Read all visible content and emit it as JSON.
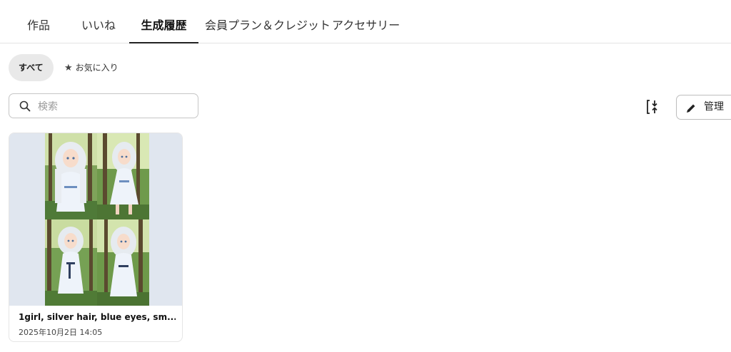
{
  "tabs": [
    {
      "label": "作品"
    },
    {
      "label": "いいね"
    },
    {
      "label": "生成履歴"
    },
    {
      "label": "会員プラン＆クレジット"
    },
    {
      "label": "アクセサリー"
    }
  ],
  "active_tab": "生成履歴",
  "filters": {
    "all_label": "すべて",
    "favorite_label": "お気に入り",
    "favorite_icon": "star-icon"
  },
  "search": {
    "placeholder": "検索",
    "value": "",
    "icon": "search-icon"
  },
  "toolbar": {
    "download_icon": "download-select-icon",
    "manage_label": "管理",
    "manage_icon": "pencil-icon"
  },
  "history": [
    {
      "title": "1girl, silver hair, blue eyes, sm...",
      "date": "2025年10月2日 14:05",
      "image_count": 4
    }
  ],
  "colors": {
    "active_underline": "#222222",
    "chip_bg": "#e9e9e9",
    "thumb_bg": "#e0e6ef"
  }
}
